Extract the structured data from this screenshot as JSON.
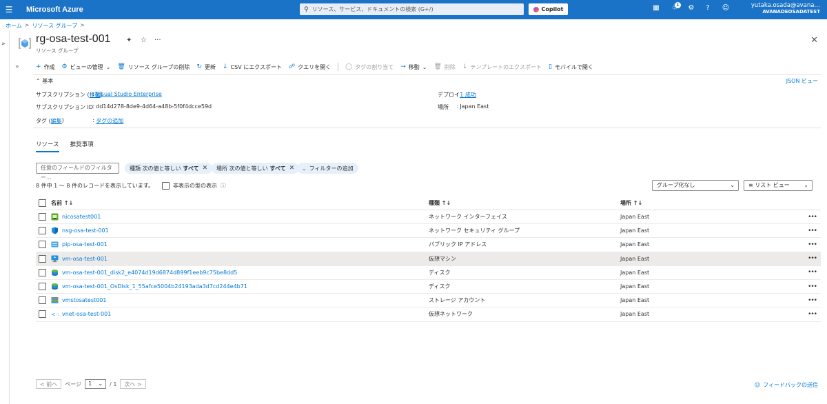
{
  "topbar": {
    "brand": "Microsoft Azure",
    "search_placeholder": "リソース、サービス、ドキュメントの検索 (G+/)",
    "copilot": "Copilot",
    "notif_count": "1",
    "user_name": "yutaka.osada@avana…",
    "user_tenant": "AVANADEOSADATEST"
  },
  "breadcrumb": {
    "home": "ホーム",
    "rg": "リソース グループ"
  },
  "header": {
    "title": "rg-osa-test-001",
    "subtitle": "リソース グループ"
  },
  "toolbar": {
    "create": "作成",
    "view_manage": "ビューの管理",
    "delete_rg": "リソース グループの削除",
    "refresh": "更新",
    "export_csv": "CSV にエクスポート",
    "open_query": "クエリを開く",
    "assign_tags": "タグの割り当て",
    "move": "移動",
    "delete": "削除",
    "export_template": "テンプレートのエクスポート",
    "open_mobile": "モバイルで開く"
  },
  "essentials": {
    "toggle": "基本",
    "json_view": "JSON ビュー",
    "subscription_label": "サブスクリプション (",
    "subscription_move": "移動",
    "subscription_label_end": ")",
    "subscription_value": "Visual Studio Enterprise",
    "subscription_id_label": "サブスクリプション ID",
    "subscription_id_value": "dd14d278-8de9-4d64-a48b-5f0f4dcce59d",
    "tags_label": "タグ (",
    "tags_edit": "編集",
    "tags_label_end": ")",
    "tags_add": "タグの追加",
    "deploy_label": "デプロイ",
    "deploy_value": "1 成功",
    "location_label": "場所",
    "location_value": "Japan East",
    "colon": ":"
  },
  "tabs": {
    "resources": "リソース",
    "recommendations": "推奨事項"
  },
  "filters": {
    "placeholder": "任意のフィールドのフィルター...",
    "type_label": "種類 次の値と等しい",
    "type_value": "すべて",
    "loc_label": "場所 次の値と等しい",
    "loc_value": "すべて",
    "add_filter": "フィルターの追加"
  },
  "records": {
    "count_text": "8 件中 1 ～ 8 件のレコードを表示しています。",
    "show_hidden": "非表示の型の表示",
    "group_by": "グループ化なし",
    "view_mode": "リスト ビュー"
  },
  "table": {
    "headers": {
      "name": "名前",
      "type": "種類",
      "location": "場所"
    },
    "rows": [
      {
        "name": "nicosatest001",
        "type": "ネットワーク インターフェイス",
        "location": "Japan East",
        "icon": "network-interface-icon"
      },
      {
        "name": "nsg-osa-test-001",
        "type": "ネットワーク セキュリティ グループ",
        "location": "Japan East",
        "icon": "nsg-shield-icon"
      },
      {
        "name": "pip-osa-test-001",
        "type": "パブリック IP アドレス",
        "location": "Japan East",
        "icon": "public-ip-icon"
      },
      {
        "name": "vm-osa-test-001",
        "type": "仮想マシン",
        "location": "Japan East",
        "icon": "vm-icon"
      },
      {
        "name": "vm-osa-test-001_disk2_e4074d19d6874d899f1eeb9c75be8dd5",
        "type": "ディスク",
        "location": "Japan East",
        "icon": "disk-icon"
      },
      {
        "name": "vm-osa-test-001_OsDisk_1_55afce5004b24193ada3d7cd244e4b71",
        "type": "ディスク",
        "location": "Japan East",
        "icon": "disk-icon"
      },
      {
        "name": "vmstosatest001",
        "type": "ストレージ アカウント",
        "location": "Japan East",
        "icon": "storage-icon"
      },
      {
        "name": "vnet-osa-test-001",
        "type": "仮想ネットワーク",
        "location": "Japan East",
        "icon": "vnet-icon"
      }
    ]
  },
  "pager": {
    "prev": "< 前へ",
    "page_label": "ページ",
    "page": "1",
    "total": "/ 1",
    "next": "次へ >"
  },
  "feedback": "フィードバックの送信",
  "colors": {
    "azure_blue": "#1a73c7",
    "link": "#0078d4"
  }
}
